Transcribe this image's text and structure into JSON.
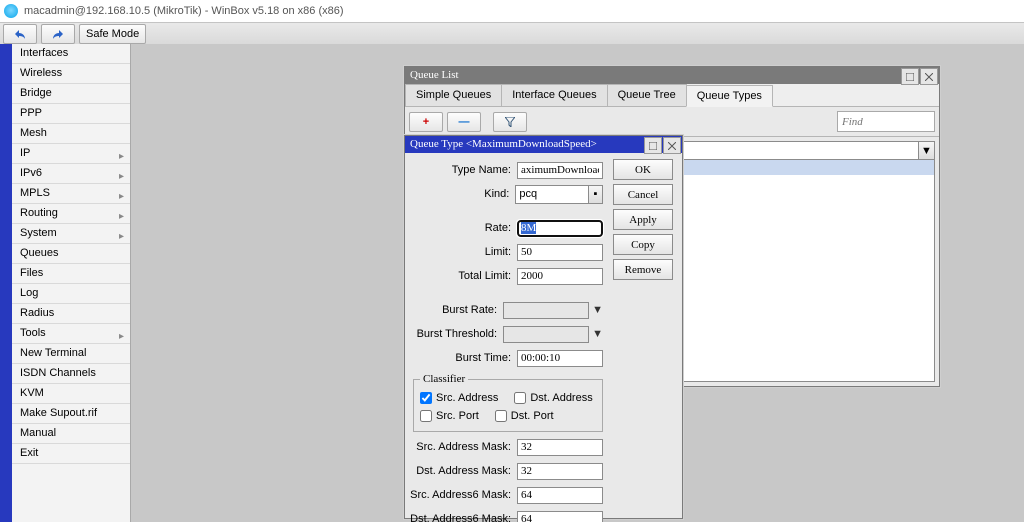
{
  "titlebar": "macadmin@192.168.10.5 (MikroTik) - WinBox v5.18 on x86 (x86)",
  "toolbar": {
    "safe_mode": "Safe Mode"
  },
  "menu": [
    {
      "label": "Interfaces"
    },
    {
      "label": "Wireless"
    },
    {
      "label": "Bridge"
    },
    {
      "label": "PPP"
    },
    {
      "label": "Mesh"
    },
    {
      "label": "IP",
      "sub": true
    },
    {
      "label": "IPv6",
      "sub": true
    },
    {
      "label": "MPLS",
      "sub": true
    },
    {
      "label": "Routing",
      "sub": true
    },
    {
      "label": "System",
      "sub": true
    },
    {
      "label": "Queues"
    },
    {
      "label": "Files"
    },
    {
      "label": "Log"
    },
    {
      "label": "Radius"
    },
    {
      "label": "Tools",
      "sub": true
    },
    {
      "label": "New Terminal"
    },
    {
      "label": "ISDN Channels"
    },
    {
      "label": "KVM"
    },
    {
      "label": "Make Supout.rif"
    },
    {
      "label": "Manual"
    },
    {
      "label": "Exit"
    }
  ],
  "qlist": {
    "title": "Queue List",
    "tabs": [
      "Simple Queues",
      "Interface Queues",
      "Queue Tree",
      "Queue Types"
    ],
    "active_tab": 3,
    "find_placeholder": "Find"
  },
  "qtype": {
    "title": "Queue Type <MaximumDownloadSpeed>",
    "labels": {
      "type_name": "Type Name:",
      "kind": "Kind:",
      "rate": "Rate:",
      "limit": "Limit:",
      "total_limit": "Total Limit:",
      "burst_rate": "Burst Rate:",
      "burst_threshold": "Burst Threshold:",
      "burst_time": "Burst Time:",
      "src_addr": "Src. Address",
      "dst_addr": "Dst. Address",
      "src_port": "Src. Port",
      "dst_port": "Dst. Port",
      "src_mask": "Src. Address Mask:",
      "dst_mask": "Dst. Address Mask:",
      "src6_mask": "Src. Address6 Mask:",
      "dst6_mask": "Dst. Address6 Mask:",
      "classifier": "Classifier"
    },
    "values": {
      "type_name": "aximumDownloadSpeed",
      "kind": "pcq",
      "rate": "8M",
      "limit": "50",
      "total_limit": "2000",
      "burst_rate": "",
      "burst_threshold": "",
      "burst_time": "00:00:10",
      "src_mask": "32",
      "dst_mask": "32",
      "src6_mask": "64",
      "dst6_mask": "64",
      "src_addr_checked": true,
      "dst_addr_checked": false,
      "src_port_checked": false,
      "dst_port_checked": false
    },
    "buttons": {
      "ok": "OK",
      "cancel": "Cancel",
      "apply": "Apply",
      "copy": "Copy",
      "remove": "Remove"
    }
  }
}
